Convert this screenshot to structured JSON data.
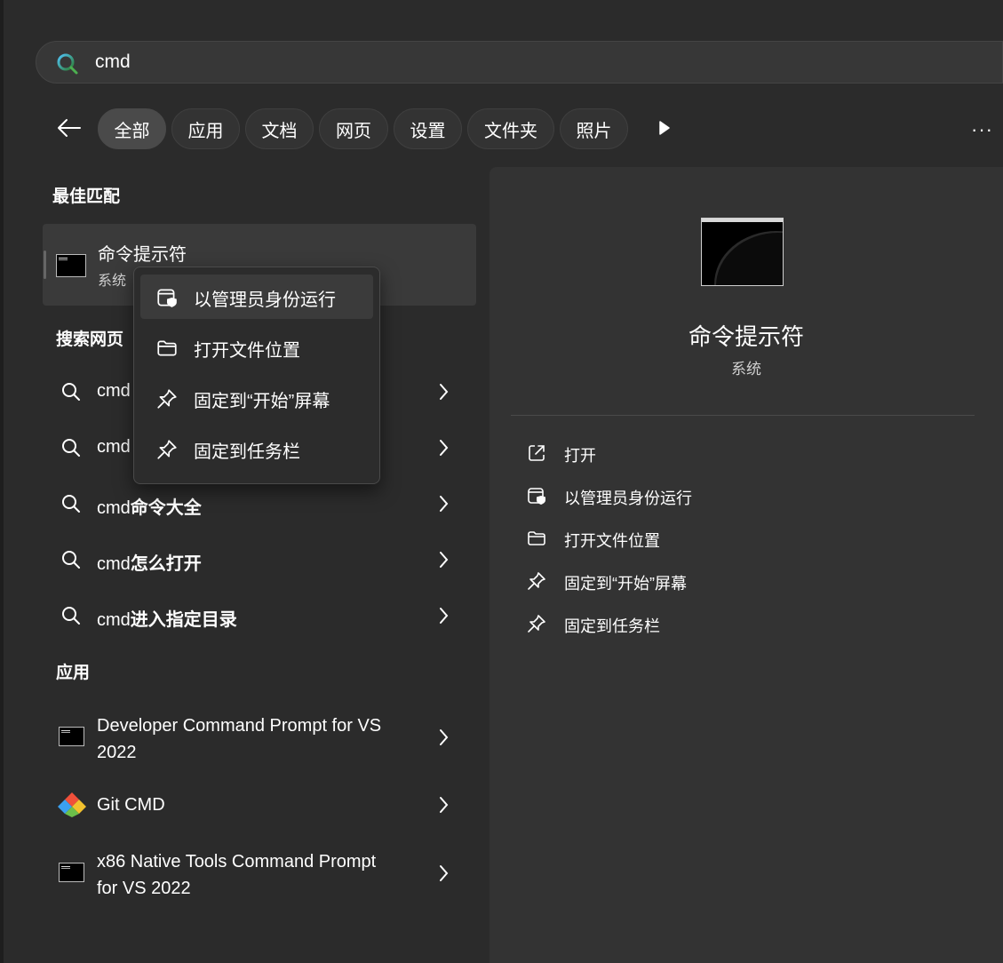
{
  "search": {
    "query": "cmd"
  },
  "filters": [
    {
      "label": "全部"
    },
    {
      "label": "应用"
    },
    {
      "label": "文档"
    },
    {
      "label": "网页"
    },
    {
      "label": "设置"
    },
    {
      "label": "文件夹"
    },
    {
      "label": "照片"
    }
  ],
  "more_label": "···",
  "sections": {
    "best_match": "最佳匹配",
    "search_web": "搜索网页",
    "apps": "应用"
  },
  "best_match": {
    "title": "命令提示符",
    "subtitle": "系统"
  },
  "web_results": [
    {
      "prefix": "cmd",
      "bold": ""
    },
    {
      "prefix": "cmd",
      "bold": ""
    },
    {
      "prefix": "cmd",
      "bold": "命令大全"
    },
    {
      "prefix": "cmd",
      "bold": "怎么打开"
    },
    {
      "prefix": "cmd",
      "bold": "进入指定目录"
    }
  ],
  "apps": [
    {
      "title": "Developer Command Prompt for VS 2022",
      "icon": "cmd-icon"
    },
    {
      "title": "Git CMD",
      "icon": "git-icon"
    },
    {
      "title": "x86 Native Tools Command Prompt for VS 2022",
      "icon": "cmd-icon"
    }
  ],
  "context_menu": [
    {
      "label": "以管理员身份运行",
      "icon": "shield-window-icon"
    },
    {
      "label": "打开文件位置",
      "icon": "folder-icon"
    },
    {
      "label": "固定到“开始”屏幕",
      "icon": "pin-icon"
    },
    {
      "label": "固定到任务栏",
      "icon": "pin-icon"
    }
  ],
  "detail": {
    "title": "命令提示符",
    "subtitle": "系统",
    "actions": [
      {
        "label": "打开",
        "icon": "open-external-icon"
      },
      {
        "label": "以管理员身份运行",
        "icon": "shield-window-icon"
      },
      {
        "label": "打开文件位置",
        "icon": "folder-icon"
      },
      {
        "label": "固定到“开始”屏幕",
        "icon": "pin-icon"
      },
      {
        "label": "固定到任务栏",
        "icon": "pin-icon"
      }
    ]
  },
  "colors": {
    "background": "#2b2b2b",
    "panel": "#333333",
    "accent_search": "#2ea6d8"
  }
}
